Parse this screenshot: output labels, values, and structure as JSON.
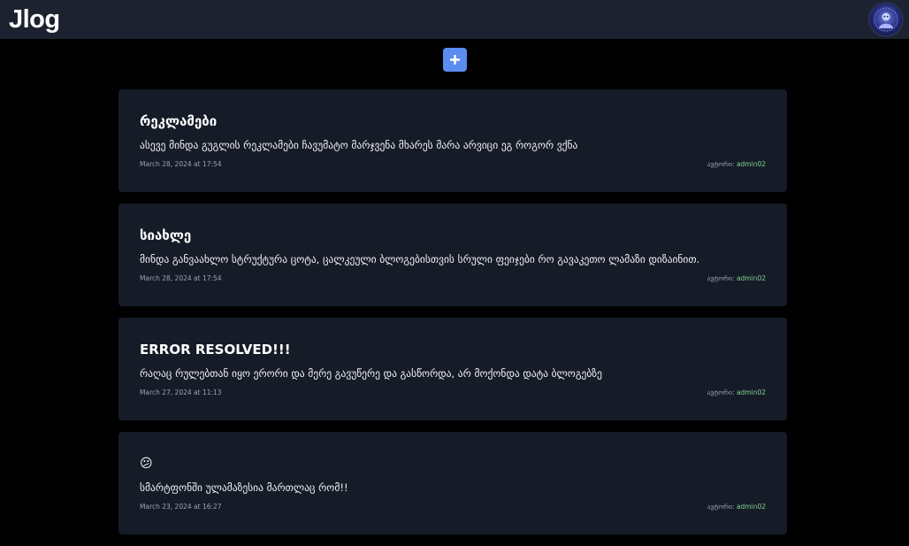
{
  "header": {
    "brand": "Jlog",
    "avatar_icon": "user-avatar-icon"
  },
  "toolbar": {
    "add_icon": "plus-icon",
    "accent": "#5b8cf0"
  },
  "colors": {
    "background": "#000000",
    "card": "#161b28",
    "header": "#1c2230",
    "author": "#7ed38d"
  },
  "posts": [
    {
      "title": "რეკლამები",
      "body": "ასევე მინდა გუგლის რეკლამები ჩავუმატო მარჯვენა მხარეს მარა არვიცი ეგ როგორ ვქნა",
      "date": "March 28, 2024 at 17:54",
      "author_label": "ავტორი:",
      "author": "admin02"
    },
    {
      "title": "სიახლე",
      "body": "მინდა განვაახლო სტრუქტურა ცოტა, ცალკეული ბლოგებისთვის სრული ფეიჯები რო გავაკეთო ლამაზი დიზაინით.",
      "date": "March 28, 2024 at 17:54",
      "author_label": "ავტორი:",
      "author": "admin02"
    },
    {
      "title": "ERROR RESOLVED!!!",
      "body": "რაღაც რულებთან იყო ერორი და მერე გავუწერე და გასწორდა, არ მოქონდა დატა ბლოგებზე",
      "date": "March 27, 2024 at 11:13",
      "author_label": "ავტორი:",
      "author": "admin02"
    },
    {
      "title": "😕",
      "body": "სმარტფონში ულამაზესია მართლაც რომ!!",
      "date": "March 23, 2024 at 16:27",
      "author_label": "ავტორი:",
      "author": "admin02"
    }
  ]
}
